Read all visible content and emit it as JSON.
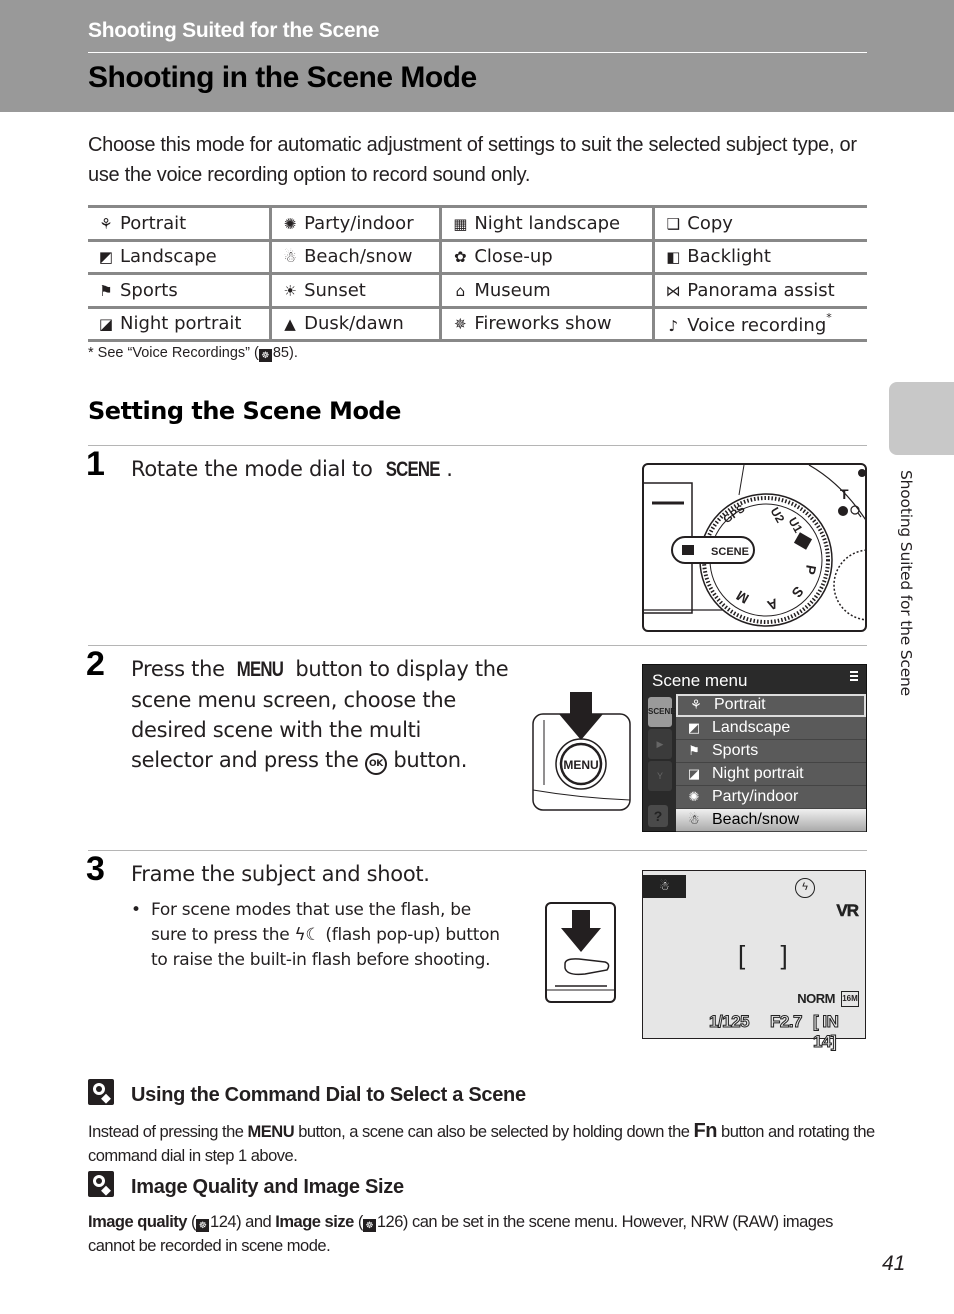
{
  "header": {
    "chapter": "Shooting Suited for the Scene",
    "title": "Shooting in the Scene Mode"
  },
  "intro": "Choose this mode for automatic adjustment of settings to suit the selected subject type, or use the voice recording option to record sound only.",
  "modes_table": {
    "rows": [
      [
        {
          "icon": "portrait-icon",
          "glyph": "⚘",
          "label": "Portrait"
        },
        {
          "icon": "party-indoor-icon",
          "glyph": "✺",
          "label": "Party/indoor"
        },
        {
          "icon": "night-landscape-icon",
          "glyph": "▦",
          "label": "Night landscape"
        },
        {
          "icon": "copy-icon",
          "glyph": "❑",
          "label": "Copy"
        }
      ],
      [
        {
          "icon": "landscape-icon",
          "glyph": "◩",
          "label": "Landscape"
        },
        {
          "icon": "beach-snow-icon",
          "glyph": "☃",
          "label": "Beach/snow"
        },
        {
          "icon": "close-up-icon",
          "glyph": "✿",
          "label": "Close-up"
        },
        {
          "icon": "backlight-icon",
          "glyph": "◧",
          "label": "Backlight"
        }
      ],
      [
        {
          "icon": "sports-icon",
          "glyph": "⚑",
          "label": "Sports"
        },
        {
          "icon": "sunset-icon",
          "glyph": "☀",
          "label": "Sunset"
        },
        {
          "icon": "museum-icon",
          "glyph": "⌂",
          "label": "Museum"
        },
        {
          "icon": "panorama-assist-icon",
          "glyph": "⋈",
          "label": "Panorama assist"
        }
      ],
      [
        {
          "icon": "night-portrait-icon",
          "glyph": "◪",
          "label": "Night portrait"
        },
        {
          "icon": "dusk-dawn-icon",
          "glyph": "▲",
          "label": "Dusk/dawn"
        },
        {
          "icon": "fireworks-show-icon",
          "glyph": "✵",
          "label": "Fireworks show"
        },
        {
          "icon": "voice-recording-icon",
          "glyph": "♪",
          "label": "Voice recording",
          "sup": "*"
        }
      ]
    ]
  },
  "footnote": {
    "prefix": "* See “Voice Recordings” (",
    "ref_page": "85",
    "suffix": ")."
  },
  "section_title": "Setting the Scene Mode",
  "steps": [
    {
      "number": "1",
      "text_before": "Rotate the mode dial to ",
      "bold": "SCENE",
      "text_after": "."
    },
    {
      "number": "2",
      "line1_before": "Press the ",
      "line1_bold": "MENU",
      "line1_after": " button to display the",
      "line2": "scene menu screen, choose the",
      "line3": "desired scene with the multi",
      "line4_before": "selector and press the ",
      "line4_icon": "OK",
      "line4_after": " button."
    },
    {
      "number": "3",
      "text": "Frame the subject and shoot.",
      "bullet": "For scene modes that use the flash, be sure to press the ϟ☾ (flash pop-up) button to raise the built-in flash before shooting."
    }
  ],
  "dial_illustration": {
    "labels": [
      "SCENE",
      "GPS",
      "U2",
      "U1",
      "P",
      "S",
      "A",
      "M"
    ],
    "zoom_labels": [
      "T",
      "?",
      "Q"
    ]
  },
  "menu_button_label": "MENU",
  "scene_menu": {
    "title": "Scene menu",
    "tabs": [
      "SCENE",
      "▶",
      "Y"
    ],
    "help": "?",
    "items": [
      {
        "icon": "portrait-icon",
        "glyph": "⚘",
        "label": "Portrait",
        "selected": true
      },
      {
        "icon": "landscape-icon",
        "glyph": "◩",
        "label": "Landscape"
      },
      {
        "icon": "sports-icon",
        "glyph": "⚑",
        "label": "Sports"
      },
      {
        "icon": "night-portrait-icon",
        "glyph": "◪",
        "label": "Night portrait"
      },
      {
        "icon": "party-indoor-icon",
        "glyph": "✺",
        "label": "Party/indoor"
      },
      {
        "icon": "beach-snow-icon",
        "glyph": "☃",
        "label": "Beach/snow"
      }
    ]
  },
  "monitor": {
    "scene_glyph": "☃",
    "flash_glyph": "ϟ",
    "vr": "VR",
    "bracket": "[ ]",
    "quality": "NORM",
    "size": "16M",
    "shutter": "1/125",
    "aperture": "F2.7",
    "memory": "[ IN 14]"
  },
  "notes": [
    {
      "title": "Using the Command Dial to Select a Scene",
      "p1": "Instead of pressing the ",
      "b1": "MENU",
      "p2": " button, a scene can also be selected by holding down the ",
      "b2": "Fn",
      "p3": " button and rotating the command dial in step 1 above."
    },
    {
      "title": "Image Quality and Image Size",
      "b1": "Image quality",
      "p1": " (",
      "ref1": "124",
      "p2": ") and ",
      "b2": "Image size",
      "p3": " (",
      "ref2": "126",
      "p4": ") can be set in the scene menu. However, NRW (RAW) images cannot be recorded in scene mode."
    }
  ],
  "side_tab_label": "Shooting Suited for the Scene",
  "page_number": "41"
}
